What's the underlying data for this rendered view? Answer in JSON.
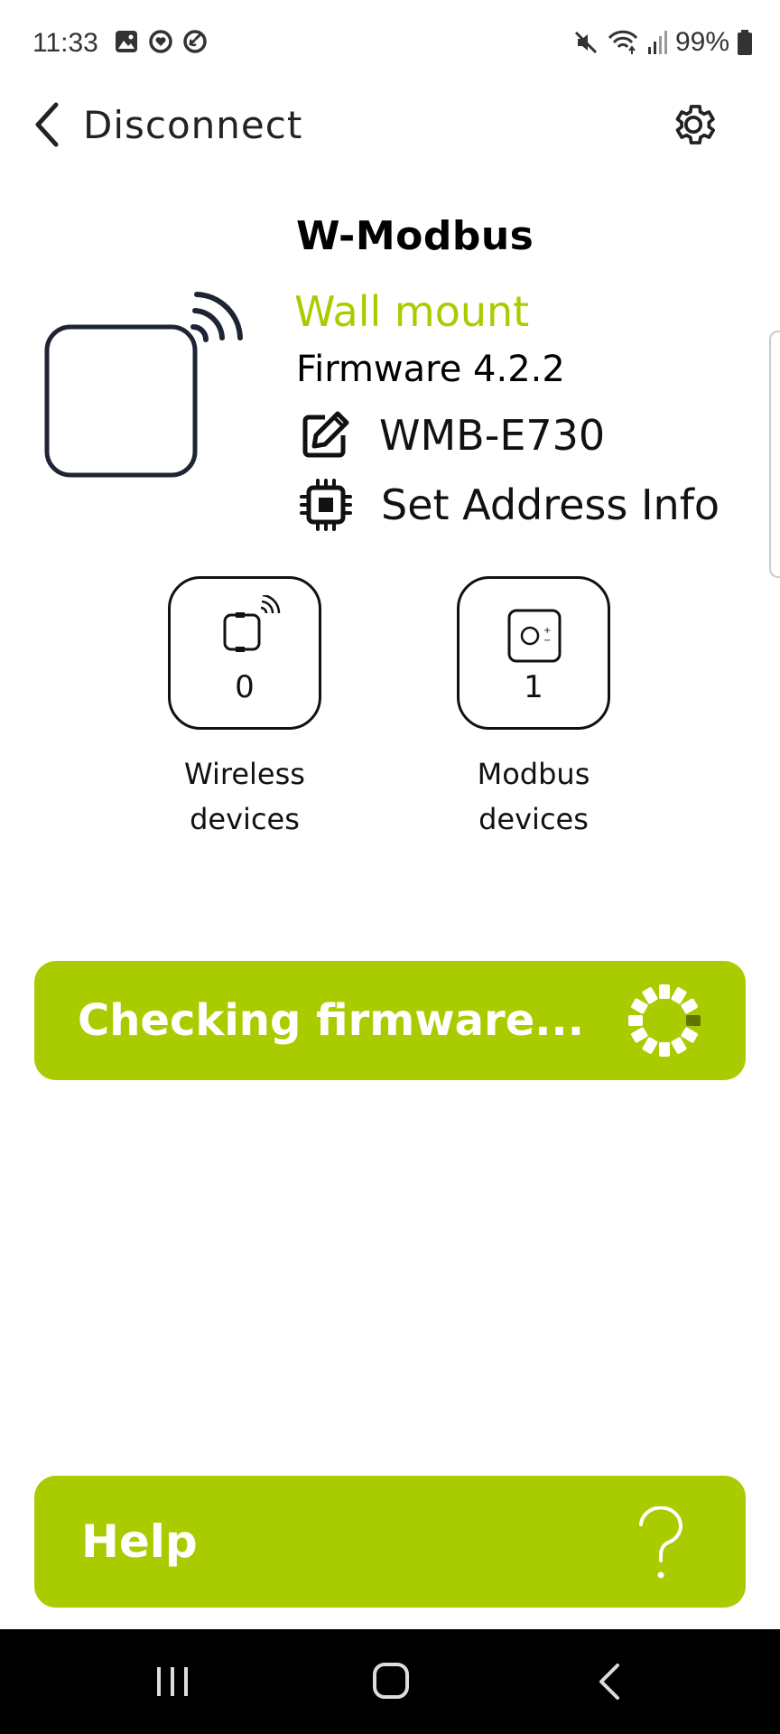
{
  "status_bar": {
    "time": "11:33",
    "battery": "99%",
    "left_icons": [
      "gallery-icon",
      "heart-notification-icon",
      "link-icon"
    ],
    "right_icons": [
      "mute-icon",
      "wifi-icon",
      "signal-icon",
      "battery-icon"
    ]
  },
  "header": {
    "back_label": "Disconnect",
    "back_icon": "chevron-left-icon",
    "settings_icon": "gear-icon"
  },
  "device": {
    "name": "W-Modbus",
    "mount": "Wall mount",
    "firmware": "Firmware 4.2.2",
    "id": "WMB-E730",
    "address_action": "Set Address Info",
    "illustration_icon": "wireless-device-icon"
  },
  "tiles": [
    {
      "count": "0",
      "label_line1": "Wireless",
      "label_line2": "devices",
      "icon": "wireless-device-icon"
    },
    {
      "count": "1",
      "label_line1": "Modbus",
      "label_line2": "devices",
      "icon": "modbus-device-icon"
    }
  ],
  "firmware_button": {
    "label": "Checking firmware...",
    "icon": "loading-spinner-icon"
  },
  "help_button": {
    "label": "Help",
    "icon": "question-mark-icon"
  },
  "colors": {
    "accent": "#a9cc00",
    "text": "#111111",
    "navbar": "#000000"
  }
}
